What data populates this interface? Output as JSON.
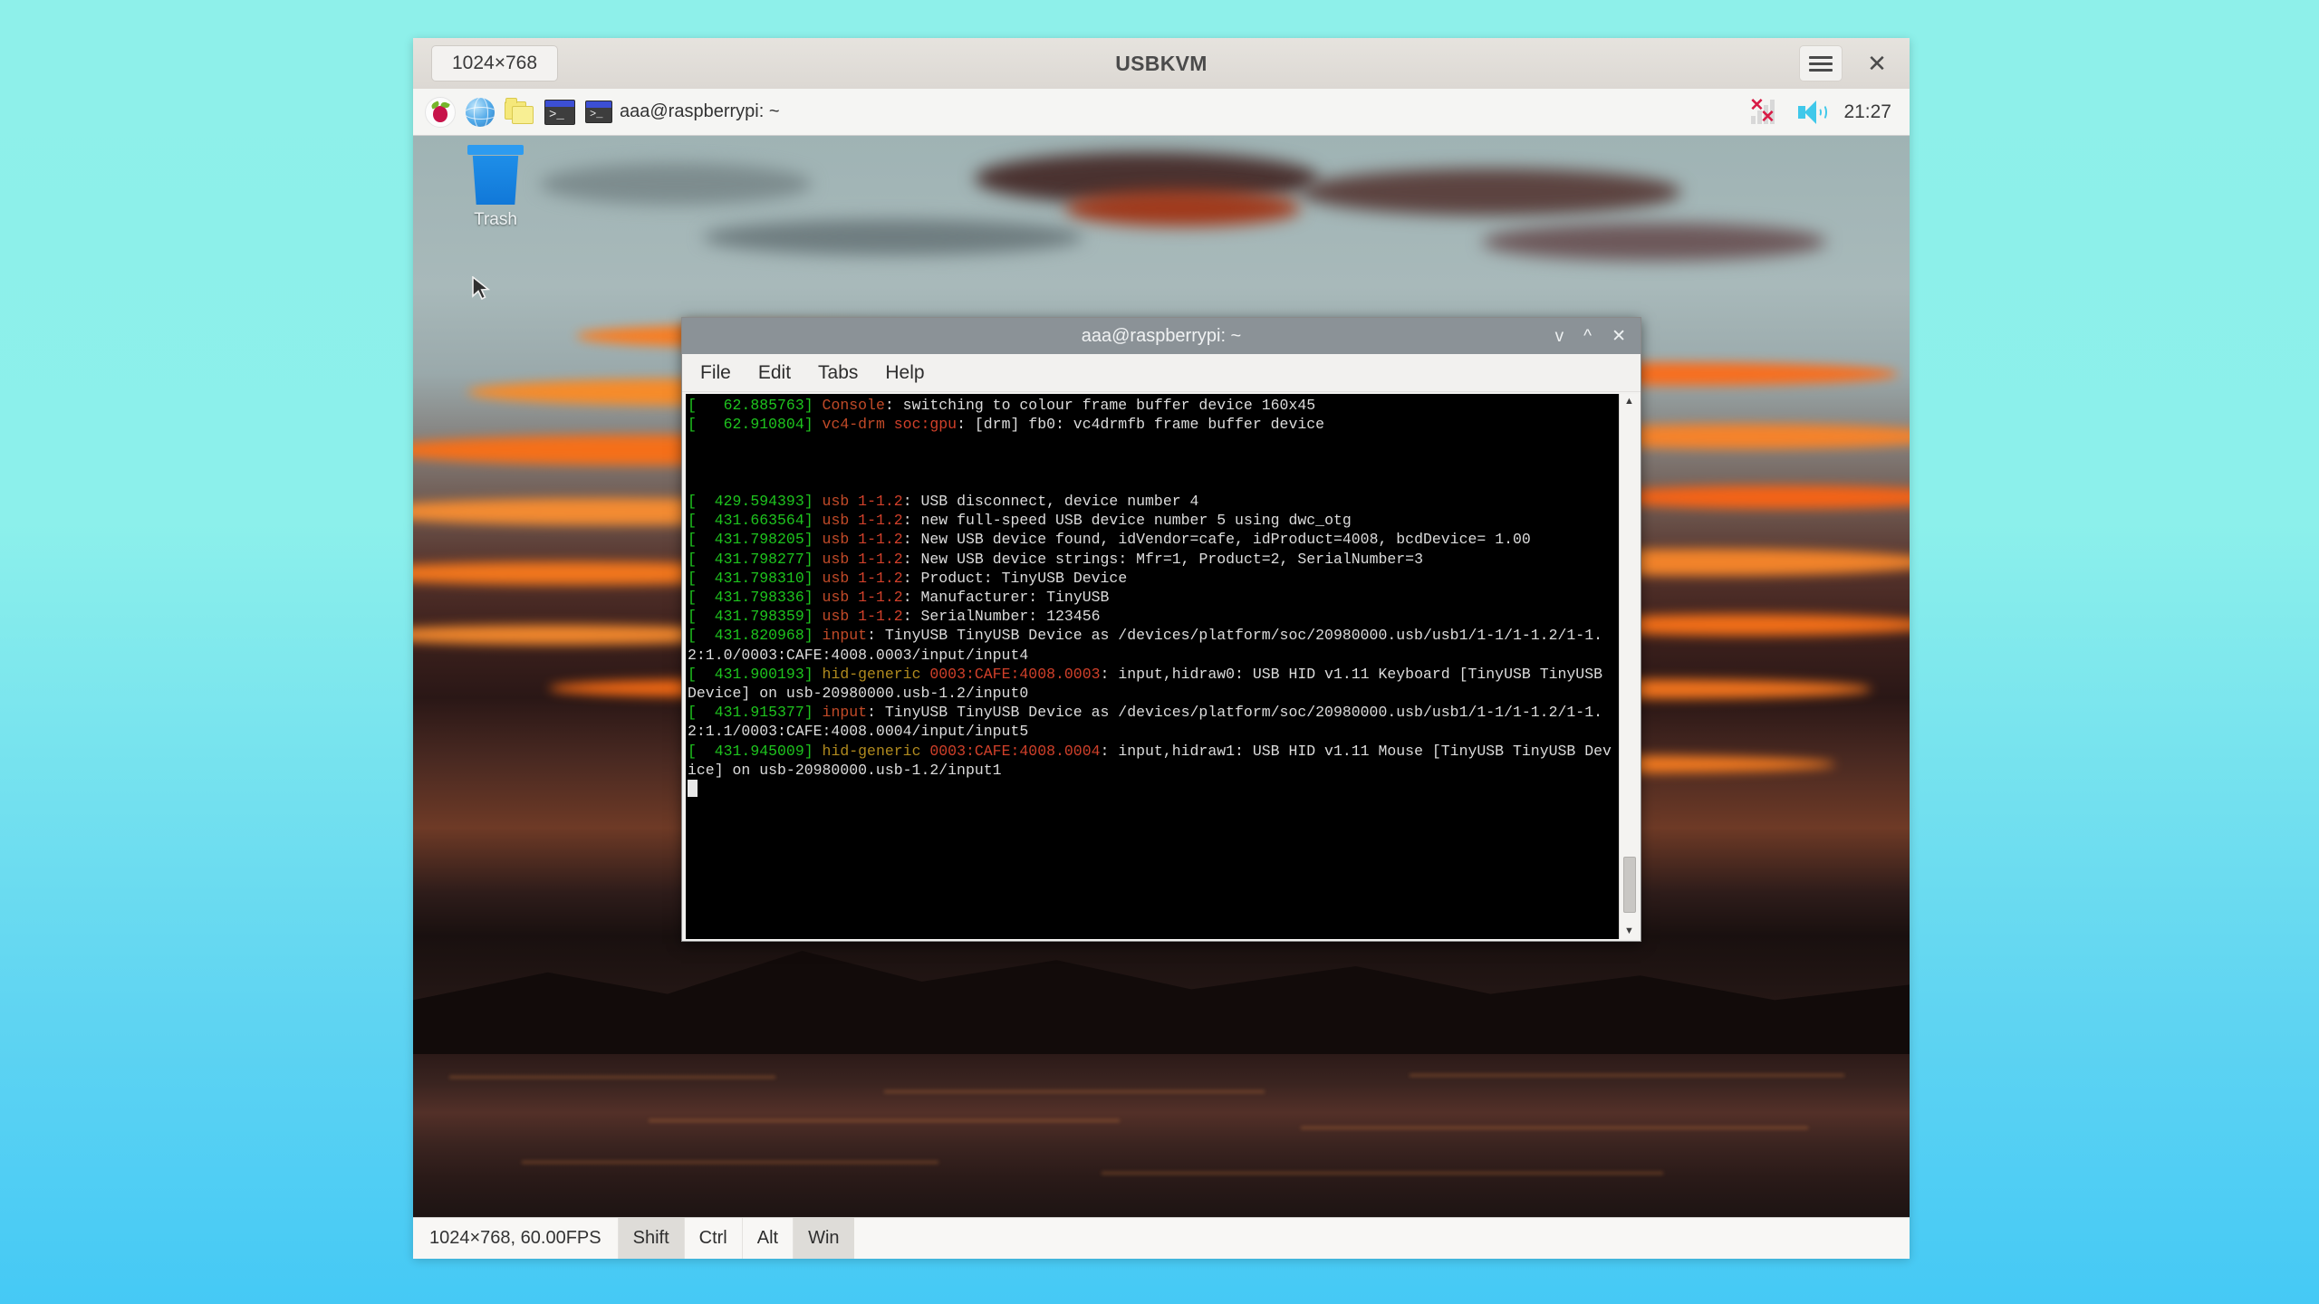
{
  "app": {
    "title": "USBKVM",
    "resolution_chip": "1024×768",
    "menu_icon": "hamburger-menu-icon",
    "close_icon": "close-icon"
  },
  "statusbar": {
    "info": "1024×768, 60.00FPS",
    "modifiers": [
      {
        "label": "Shift",
        "active": true
      },
      {
        "label": "Ctrl",
        "active": false
      },
      {
        "label": "Alt",
        "active": false
      },
      {
        "label": "Win",
        "active": true
      }
    ]
  },
  "remote": {
    "taskbar": {
      "launchers": [
        {
          "name": "raspberry-menu-icon",
          "label": ""
        },
        {
          "name": "web-browser-icon",
          "label": ""
        },
        {
          "name": "file-manager-icon",
          "label": ""
        },
        {
          "name": "terminal-icon",
          "label": ""
        }
      ],
      "task_button": "aaa@raspberrypi: ~",
      "tray": {
        "network_status": "disconnected",
        "volume": "volume-icon",
        "clock": "21:27"
      }
    },
    "desktop": {
      "icons": [
        {
          "name": "trash-icon",
          "label": "Trash"
        }
      ]
    },
    "terminal": {
      "title": "aaa@raspberrypi: ~",
      "window_buttons": {
        "minimize": "v",
        "maximize": "^",
        "close": "✕"
      },
      "menu": [
        "File",
        "Edit",
        "Tabs",
        "Help"
      ],
      "lines": [
        {
          "type": "log",
          "time": "62.885763",
          "tag": "Console",
          "tag2": "",
          "text": ": switching to colour frame buffer device 160x45"
        },
        {
          "type": "log",
          "time": "62.910804",
          "tag": "vc4-drm",
          "tag2": "soc:gpu",
          "text": ": [drm] fb0: vc4drmfb frame buffer device"
        },
        {
          "type": "blank"
        },
        {
          "type": "blank"
        },
        {
          "type": "blank"
        },
        {
          "type": "log",
          "time": "429.594393",
          "tag": "usb",
          "tag2": "1-1.2",
          "text": ": USB disconnect, device number 4"
        },
        {
          "type": "log",
          "time": "431.663564",
          "tag": "usb",
          "tag2": "1-1.2",
          "text": ": new full-speed USB device number 5 using dwc_otg"
        },
        {
          "type": "log",
          "time": "431.798205",
          "tag": "usb",
          "tag2": "1-1.2",
          "text": ": New USB device found, idVendor=cafe, idProduct=4008, bcdDevice= 1.00"
        },
        {
          "type": "log",
          "time": "431.798277",
          "tag": "usb",
          "tag2": "1-1.2",
          "text": ": New USB device strings: Mfr=1, Product=2, SerialNumber=3"
        },
        {
          "type": "log",
          "time": "431.798310",
          "tag": "usb",
          "tag2": "1-1.2",
          "text": ": Product: TinyUSB Device"
        },
        {
          "type": "log",
          "time": "431.798336",
          "tag": "usb",
          "tag2": "1-1.2",
          "text": ": Manufacturer: TinyUSB"
        },
        {
          "type": "log",
          "time": "431.798359",
          "tag": "usb",
          "tag2": "1-1.2",
          "text": ": SerialNumber: 123456"
        },
        {
          "type": "log",
          "time": "431.820968",
          "tag": "input",
          "tag2": "",
          "text": ": TinyUSB TinyUSB Device as /devices/platform/soc/20980000.usb/usb1/1-1/1-1.2/1-1.2:1.0/0003:CAFE:4008.0003/input/input4"
        },
        {
          "type": "hid",
          "time": "431.900193",
          "tag": "hid-generic",
          "tag2": "0003:CAFE:4008.0003",
          "text": ": input,hidraw0: USB HID v1.11 Keyboard [TinyUSB TinyUSB Device] on usb-20980000.usb-1.2/input0"
        },
        {
          "type": "log",
          "time": "431.915377",
          "tag": "input",
          "tag2": "",
          "text": ": TinyUSB TinyUSB Device as /devices/platform/soc/20980000.usb/usb1/1-1/1-1.2/1-1.2:1.1/0003:CAFE:4008.0004/input/input5"
        },
        {
          "type": "hid",
          "time": "431.945009",
          "tag": "hid-generic",
          "tag2": "0003:CAFE:4008.0004",
          "text": ": input,hidraw1: USB HID v1.11 Mouse [TinyUSB TinyUSB Device] on usb-20980000.usb-1.2/input1"
        }
      ]
    }
  },
  "colors": {
    "page_bg_top": "#8ef0ea",
    "page_bg_bottom": "#45c9f5",
    "terminal_bg": "#000000",
    "log_time": "#1ec41e",
    "log_subsystem": "#c14a28",
    "log_device": "#d0402a",
    "log_hid": "#b08a1e",
    "accent_title_bar": "#8b9297",
    "network_error": "#d81b45",
    "volume_icon": "#3fc8ea"
  }
}
